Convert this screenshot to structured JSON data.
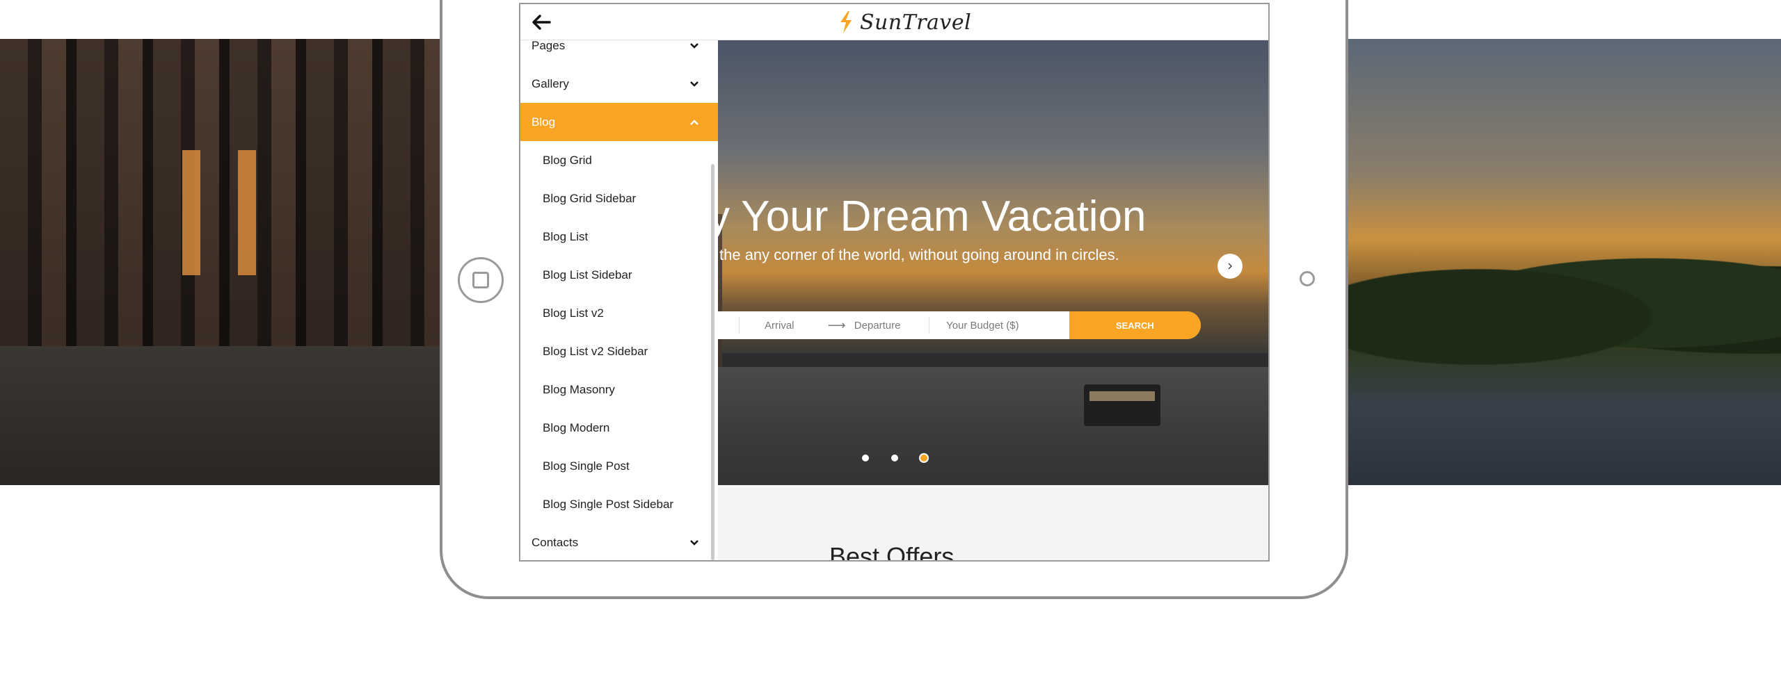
{
  "app": {
    "logo_text": "SunTravel"
  },
  "menu": {
    "items": [
      {
        "label": "Pages"
      },
      {
        "label": "Gallery"
      },
      {
        "label": "Blog"
      },
      {
        "label": "Contacts"
      }
    ],
    "blog_submenu": [
      "Blog Grid",
      "Blog Grid Sidebar",
      "Blog List",
      "Blog List Sidebar",
      "Blog List v2",
      "Blog List v2 Sidebar",
      "Blog Masonry",
      "Blog Modern",
      "Blog Single Post",
      "Blog Single Post Sidebar"
    ]
  },
  "hero": {
    "title": "y Your Dream Vacation",
    "subtitle": "the any corner of the world, without going around in circles.",
    "search": {
      "arrival_placeholder": "Arrival",
      "departure_placeholder": "Departure",
      "budget_placeholder": "Your Budget ($)",
      "button_label": "SEARCH"
    },
    "slider": {
      "total_slides": 3,
      "active_slide": 3
    }
  },
  "offers": {
    "title": "Best Offers"
  },
  "colors": {
    "accent": "#f9a423",
    "text": "#222222",
    "frame": "#8e8e8e"
  }
}
